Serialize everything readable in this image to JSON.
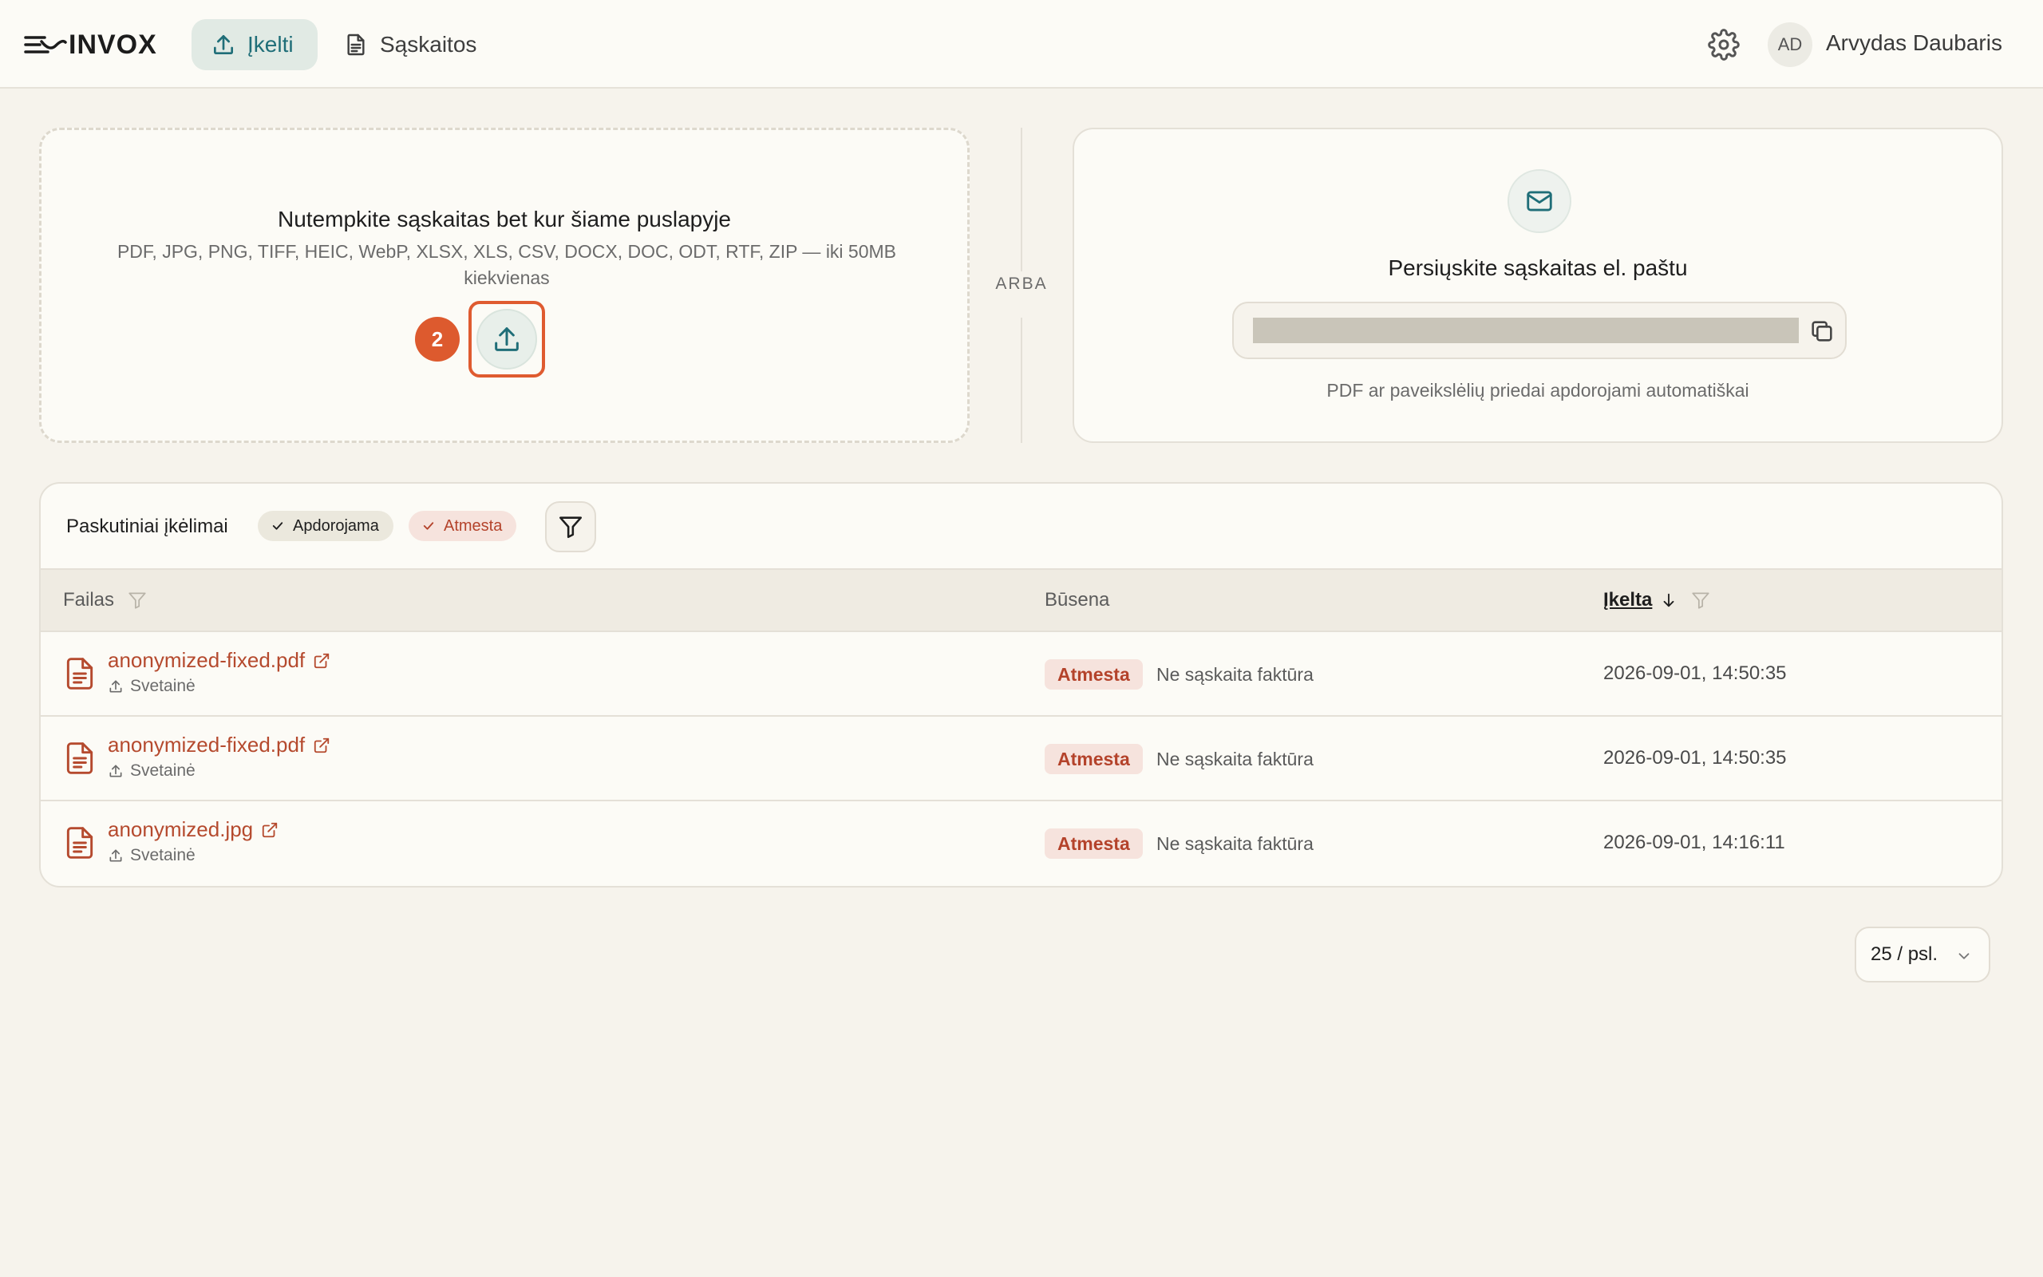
{
  "app": {
    "name": "INVOX"
  },
  "nav": {
    "upload_label": "Įkelti",
    "invoices_label": "Sąskaitos"
  },
  "user": {
    "initials": "AD",
    "name": "Arvydas Daubaris"
  },
  "dropzone": {
    "title": "Nutempkite sąskaitas bet kur šiame puslapyje",
    "formats": "PDF, JPG, PNG, TIFF, HEIC, WebP, XLSX, XLS, CSV, DOCX, DOC, ODT, RTF, ZIP — iki 50MB kiekvienas",
    "step_badge": "2"
  },
  "divider_label": "ARBA",
  "email_card": {
    "title": "Persiųskite sąskaitas el. paštu",
    "note": "PDF ar paveikslėlių priedai apdorojami automatiškai"
  },
  "recent": {
    "title": "Paskutiniai įkėlimai",
    "chips": {
      "processing": "Apdorojama",
      "rejected": "Atmesta"
    },
    "columns": {
      "file": "Failas",
      "status": "Būsena",
      "uploaded": "Įkelta"
    },
    "rows": [
      {
        "name": "anonymized-fixed.pdf",
        "source": "Svetainė",
        "status": "Atmesta",
        "reason": "Ne sąskaita faktūra",
        "date": "2026-09-01, 14:50:35"
      },
      {
        "name": "anonymized-fixed.pdf",
        "source": "Svetainė",
        "status": "Atmesta",
        "reason": "Ne sąskaita faktūra",
        "date": "2026-09-01, 14:50:35"
      },
      {
        "name": "anonymized.jpg",
        "source": "Svetainė",
        "status": "Atmesta",
        "reason": "Ne sąskaita faktūra",
        "date": "2026-09-01, 14:16:11"
      }
    ]
  },
  "pagination": {
    "page_size": "25 / psl."
  },
  "colors": {
    "accent": "#1f6e78",
    "danger": "#b4432b",
    "step_badge": "#dd5a2e",
    "background": "#f6f3ec"
  }
}
